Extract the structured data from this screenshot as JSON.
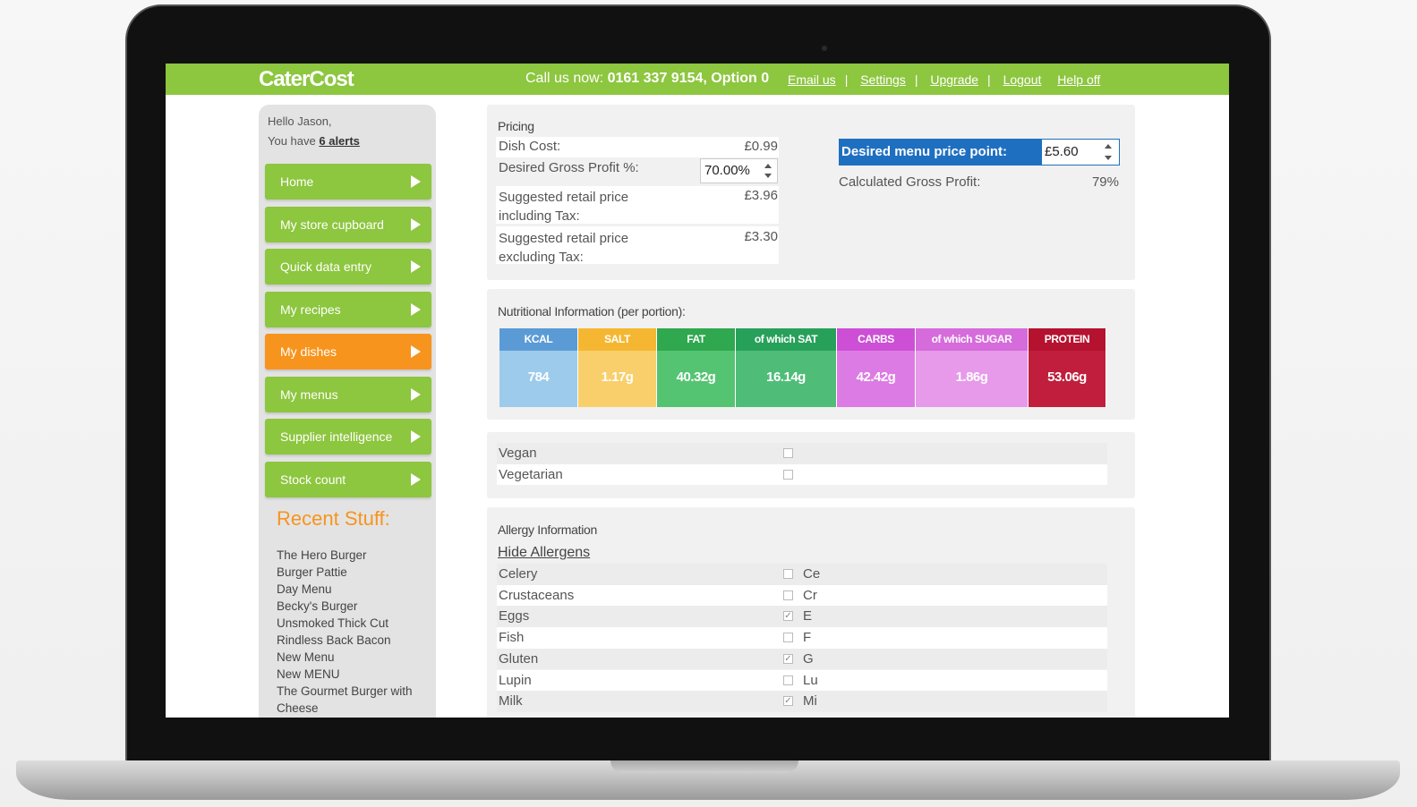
{
  "app": {
    "logo": "CaterCost",
    "call_label": "Call us now:",
    "call_number": "0161 337 9154, Option 0",
    "links": [
      "Email us",
      "Settings",
      "Upgrade",
      "Logout",
      "Help off"
    ]
  },
  "sidebar": {
    "greeting": "Hello Jason,",
    "alerts_prefix": "You have",
    "alerts_link": "6 alerts",
    "nav": [
      "Home",
      "My store cupboard",
      "Quick data entry",
      "My recipes",
      "My dishes",
      "My menus",
      "Supplier intelligence",
      "Stock count"
    ],
    "active_index": 4,
    "recent_title": "Recent Stuff:",
    "recent_items": [
      "The Hero Burger",
      "Burger Pattie",
      "Day Menu",
      "Becky's Burger",
      "Unsmoked Thick Cut",
      "Rindless Back Bacon",
      "New Menu",
      "New MENU",
      "The Gourmet Burger with Cheese"
    ]
  },
  "pricing": {
    "title": "Pricing",
    "dish_cost_label": "Dish Cost:",
    "dish_cost": "£0.99",
    "desired_gp_label": "Desired Gross Profit %:",
    "desired_gp": "70.00%",
    "srp_inc_label": "Suggested retail price including Tax:",
    "srp_inc": "£3.96",
    "srp_exc_label": "Suggested retail price excluding Tax:",
    "srp_exc": "£3.30",
    "desired_price_label": "Desired menu price point:",
    "desired_price": "£5.60",
    "calc_gp_label": "Calculated Gross Profit:",
    "calc_gp": "79%"
  },
  "nutrition": {
    "title": "Nutritional Information (per portion):",
    "items": [
      {
        "label": "KCAL",
        "value": "784",
        "head": "#5b9bd5",
        "body": "#9ccbeb",
        "w": 88
      },
      {
        "label": "SALT",
        "value": "1.17g",
        "head": "#f5b731",
        "body": "#f9cf6b",
        "w": 88
      },
      {
        "label": "FAT",
        "value": "40.32g",
        "head": "#2fa84f",
        "body": "#55c472",
        "w": 88
      },
      {
        "label": "of which SAT",
        "value": "16.14g",
        "head": "#27a15a",
        "body": "#4fbd78",
        "w": 113
      },
      {
        "label": "CARBS",
        "value": "42.42g",
        "head": "#cc4fd6",
        "body": "#dd7be5",
        "w": 88
      },
      {
        "label": "of which SUGAR",
        "value": "1.86g",
        "head": "#d66bdb",
        "body": "#e79ae9",
        "w": 126
      },
      {
        "label": "PROTEIN",
        "value": "53.06g",
        "head": "#b5122f",
        "body": "#c01e3c",
        "w": 87
      }
    ]
  },
  "diet": [
    {
      "label": "Vegan",
      "checked": false
    },
    {
      "label": "Vegetarian",
      "checked": false
    }
  ],
  "allergy": {
    "title": "Allergy Information",
    "toggle": "Hide Allergens",
    "items": [
      {
        "label": "Celery",
        "abbr": "Ce",
        "checked": false
      },
      {
        "label": "Crustaceans",
        "abbr": "Cr",
        "checked": false
      },
      {
        "label": "Eggs",
        "abbr": "E",
        "checked": true
      },
      {
        "label": "Fish",
        "abbr": "F",
        "checked": false
      },
      {
        "label": "Gluten",
        "abbr": "G",
        "checked": true
      },
      {
        "label": "Lupin",
        "abbr": "Lu",
        "checked": false
      },
      {
        "label": "Milk",
        "abbr": "Mi",
        "checked": true
      }
    ]
  },
  "colors": {
    "brand_green": "#8dc63f",
    "accent_orange": "#f7941d",
    "highlight_blue": "#1f6fc1"
  }
}
